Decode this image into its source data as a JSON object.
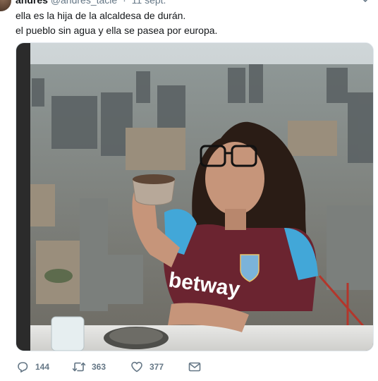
{
  "tweet": {
    "display_name": "andres",
    "handle": "@andres_tacle",
    "time": "11 sept.",
    "text_lines": [
      "ella es la hija de la alcaldesa de durán.",
      "el pueblo sin agua y ella se pasea por europa."
    ],
    "photo": {
      "jersey_sponsor": "betway"
    }
  },
  "actions": {
    "reply_count": "144",
    "retweet_count": "363",
    "like_count": "377"
  },
  "colors": {
    "text": "#14171a",
    "secondary": "#657786",
    "border": "#e1e8ed"
  },
  "icons": [
    "avatar",
    "chevron-down-icon",
    "reply-icon",
    "retweet-icon",
    "heart-icon",
    "envelope-icon"
  ]
}
